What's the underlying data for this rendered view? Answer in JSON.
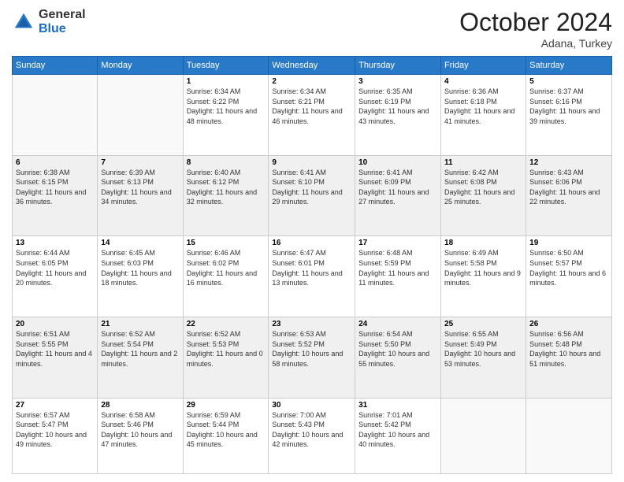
{
  "header": {
    "logo_general": "General",
    "logo_blue": "Blue",
    "month_title": "October 2024",
    "location": "Adana, Turkey"
  },
  "weekdays": [
    "Sunday",
    "Monday",
    "Tuesday",
    "Wednesday",
    "Thursday",
    "Friday",
    "Saturday"
  ],
  "weeks": [
    [
      {
        "day": "",
        "sunrise": "",
        "sunset": "",
        "daylight": ""
      },
      {
        "day": "",
        "sunrise": "",
        "sunset": "",
        "daylight": ""
      },
      {
        "day": "1",
        "sunrise": "Sunrise: 6:34 AM",
        "sunset": "Sunset: 6:22 PM",
        "daylight": "Daylight: 11 hours and 48 minutes."
      },
      {
        "day": "2",
        "sunrise": "Sunrise: 6:34 AM",
        "sunset": "Sunset: 6:21 PM",
        "daylight": "Daylight: 11 hours and 46 minutes."
      },
      {
        "day": "3",
        "sunrise": "Sunrise: 6:35 AM",
        "sunset": "Sunset: 6:19 PM",
        "daylight": "Daylight: 11 hours and 43 minutes."
      },
      {
        "day": "4",
        "sunrise": "Sunrise: 6:36 AM",
        "sunset": "Sunset: 6:18 PM",
        "daylight": "Daylight: 11 hours and 41 minutes."
      },
      {
        "day": "5",
        "sunrise": "Sunrise: 6:37 AM",
        "sunset": "Sunset: 6:16 PM",
        "daylight": "Daylight: 11 hours and 39 minutes."
      }
    ],
    [
      {
        "day": "6",
        "sunrise": "Sunrise: 6:38 AM",
        "sunset": "Sunset: 6:15 PM",
        "daylight": "Daylight: 11 hours and 36 minutes."
      },
      {
        "day": "7",
        "sunrise": "Sunrise: 6:39 AM",
        "sunset": "Sunset: 6:13 PM",
        "daylight": "Daylight: 11 hours and 34 minutes."
      },
      {
        "day": "8",
        "sunrise": "Sunrise: 6:40 AM",
        "sunset": "Sunset: 6:12 PM",
        "daylight": "Daylight: 11 hours and 32 minutes."
      },
      {
        "day": "9",
        "sunrise": "Sunrise: 6:41 AM",
        "sunset": "Sunset: 6:10 PM",
        "daylight": "Daylight: 11 hours and 29 minutes."
      },
      {
        "day": "10",
        "sunrise": "Sunrise: 6:41 AM",
        "sunset": "Sunset: 6:09 PM",
        "daylight": "Daylight: 11 hours and 27 minutes."
      },
      {
        "day": "11",
        "sunrise": "Sunrise: 6:42 AM",
        "sunset": "Sunset: 6:08 PM",
        "daylight": "Daylight: 11 hours and 25 minutes."
      },
      {
        "day": "12",
        "sunrise": "Sunrise: 6:43 AM",
        "sunset": "Sunset: 6:06 PM",
        "daylight": "Daylight: 11 hours and 22 minutes."
      }
    ],
    [
      {
        "day": "13",
        "sunrise": "Sunrise: 6:44 AM",
        "sunset": "Sunset: 6:05 PM",
        "daylight": "Daylight: 11 hours and 20 minutes."
      },
      {
        "day": "14",
        "sunrise": "Sunrise: 6:45 AM",
        "sunset": "Sunset: 6:03 PM",
        "daylight": "Daylight: 11 hours and 18 minutes."
      },
      {
        "day": "15",
        "sunrise": "Sunrise: 6:46 AM",
        "sunset": "Sunset: 6:02 PM",
        "daylight": "Daylight: 11 hours and 16 minutes."
      },
      {
        "day": "16",
        "sunrise": "Sunrise: 6:47 AM",
        "sunset": "Sunset: 6:01 PM",
        "daylight": "Daylight: 11 hours and 13 minutes."
      },
      {
        "day": "17",
        "sunrise": "Sunrise: 6:48 AM",
        "sunset": "Sunset: 5:59 PM",
        "daylight": "Daylight: 11 hours and 11 minutes."
      },
      {
        "day": "18",
        "sunrise": "Sunrise: 6:49 AM",
        "sunset": "Sunset: 5:58 PM",
        "daylight": "Daylight: 11 hours and 9 minutes."
      },
      {
        "day": "19",
        "sunrise": "Sunrise: 6:50 AM",
        "sunset": "Sunset: 5:57 PM",
        "daylight": "Daylight: 11 hours and 6 minutes."
      }
    ],
    [
      {
        "day": "20",
        "sunrise": "Sunrise: 6:51 AM",
        "sunset": "Sunset: 5:55 PM",
        "daylight": "Daylight: 11 hours and 4 minutes."
      },
      {
        "day": "21",
        "sunrise": "Sunrise: 6:52 AM",
        "sunset": "Sunset: 5:54 PM",
        "daylight": "Daylight: 11 hours and 2 minutes."
      },
      {
        "day": "22",
        "sunrise": "Sunrise: 6:52 AM",
        "sunset": "Sunset: 5:53 PM",
        "daylight": "Daylight: 11 hours and 0 minutes."
      },
      {
        "day": "23",
        "sunrise": "Sunrise: 6:53 AM",
        "sunset": "Sunset: 5:52 PM",
        "daylight": "Daylight: 10 hours and 58 minutes."
      },
      {
        "day": "24",
        "sunrise": "Sunrise: 6:54 AM",
        "sunset": "Sunset: 5:50 PM",
        "daylight": "Daylight: 10 hours and 55 minutes."
      },
      {
        "day": "25",
        "sunrise": "Sunrise: 6:55 AM",
        "sunset": "Sunset: 5:49 PM",
        "daylight": "Daylight: 10 hours and 53 minutes."
      },
      {
        "day": "26",
        "sunrise": "Sunrise: 6:56 AM",
        "sunset": "Sunset: 5:48 PM",
        "daylight": "Daylight: 10 hours and 51 minutes."
      }
    ],
    [
      {
        "day": "27",
        "sunrise": "Sunrise: 6:57 AM",
        "sunset": "Sunset: 5:47 PM",
        "daylight": "Daylight: 10 hours and 49 minutes."
      },
      {
        "day": "28",
        "sunrise": "Sunrise: 6:58 AM",
        "sunset": "Sunset: 5:46 PM",
        "daylight": "Daylight: 10 hours and 47 minutes."
      },
      {
        "day": "29",
        "sunrise": "Sunrise: 6:59 AM",
        "sunset": "Sunset: 5:44 PM",
        "daylight": "Daylight: 10 hours and 45 minutes."
      },
      {
        "day": "30",
        "sunrise": "Sunrise: 7:00 AM",
        "sunset": "Sunset: 5:43 PM",
        "daylight": "Daylight: 10 hours and 42 minutes."
      },
      {
        "day": "31",
        "sunrise": "Sunrise: 7:01 AM",
        "sunset": "Sunset: 5:42 PM",
        "daylight": "Daylight: 10 hours and 40 minutes."
      },
      {
        "day": "",
        "sunrise": "",
        "sunset": "",
        "daylight": ""
      },
      {
        "day": "",
        "sunrise": "",
        "sunset": "",
        "daylight": ""
      }
    ]
  ]
}
